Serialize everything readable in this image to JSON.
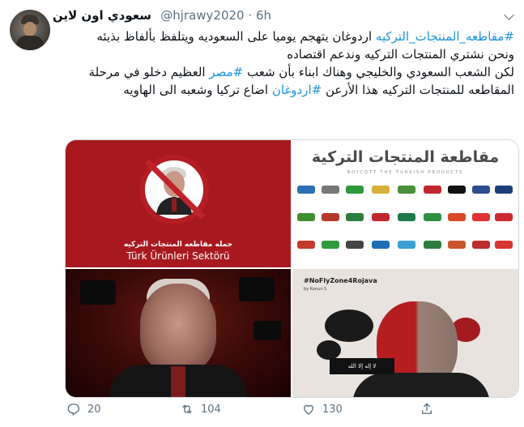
{
  "tweet": {
    "display_name": "سعودي اون لاين",
    "handle": "@hjrawy2020",
    "separator": "·",
    "time": "6h",
    "text": {
      "line1_tag": "#مقاطعه_المنتجات_التركيه",
      "line1_rest": " اردوغان يتهجم يوميا على السعوديه ويتلفظ بألفاظ بذيئه",
      "line2": "ونحن نشتري المنتجات التركيه وندعم اقتصاده",
      "line3_a": "لكن الشعب السعودي والخليجي وهناك ابناء بأن شعب ",
      "line3_tag": "#مصر",
      "line3_b": " العظيم دخلو في مرحلة المقاطعه للمنتجات التركيه  هذا الأرعن ",
      "line3_tag2": "#اردوغان",
      "line3_c": " اضاع تركيا وشعبه الى الهاويه"
    }
  },
  "media": {
    "img1": {
      "caption_ar": "حمله مقاطعه المنتجات التركيه",
      "caption_tr": "Türk Ürünleri Sektörü"
    },
    "img2": {
      "title": "مقاطعة المنتجات التركية",
      "subtitle": "BOYCOTT THE TURKISH PRODUCTS"
    },
    "img4": {
      "hashtag": "#NoFlyZone4Rojava",
      "byline": "by Kanun.S",
      "flag_text": "لا إله إلا الله"
    }
  },
  "actions": {
    "reply_count": "20",
    "retweet_count": "104",
    "like_count": "130"
  },
  "colors": {
    "link": "#1b95e0",
    "secondary": "#5b7083",
    "text": "#0f1419"
  }
}
